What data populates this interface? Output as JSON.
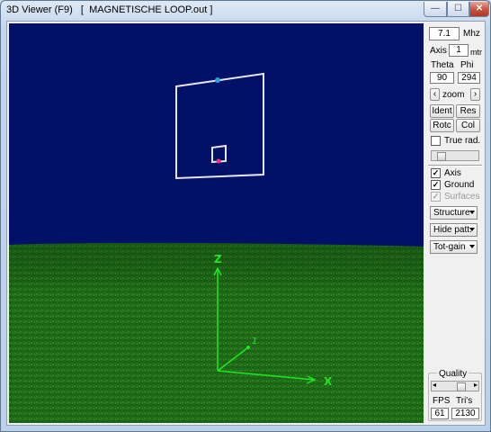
{
  "window": {
    "title": "3D Viewer (F9)   [  MAGNETISCHE LOOP.out ]",
    "min_glyph": "—",
    "max_glyph": "☐",
    "close_glyph": "✕"
  },
  "viewport": {
    "axis_x": "X",
    "axis_y": "1",
    "axis_z": "Z",
    "sky_color": "#031067",
    "ground_color": "#1f6a18",
    "axis_color": "#1ee81e"
  },
  "panel": {
    "freq_value": "7.1",
    "freq_unit": "Mhz",
    "axis_label": "Axis",
    "axis_value": "1",
    "axis_unit": "mtr",
    "theta_label": "Theta",
    "phi_label": "Phi",
    "theta_value": "90",
    "phi_value": "294",
    "zoom_left": "‹",
    "zoom_label": "zoom",
    "zoom_right": "›",
    "ident_label": "Ident",
    "res_label": "Res",
    "rotc_label": "Rotc",
    "col_label": "Col",
    "true_rad_label": "True rad.",
    "axis_check_label": "Axis",
    "ground_check_label": "Ground",
    "surfaces_check_label": "Surfaces",
    "check_mark": "✓",
    "select_structure": "Structure",
    "select_hide_patt": "Hide patt.",
    "select_tot_gain": "Tot-gain",
    "quality_label": "Quality",
    "quality_left": "◂",
    "quality_right": "▸",
    "fps_label": "FPS",
    "tris_label": "Tri's",
    "fps_value": "61",
    "tris_value": "2130"
  }
}
